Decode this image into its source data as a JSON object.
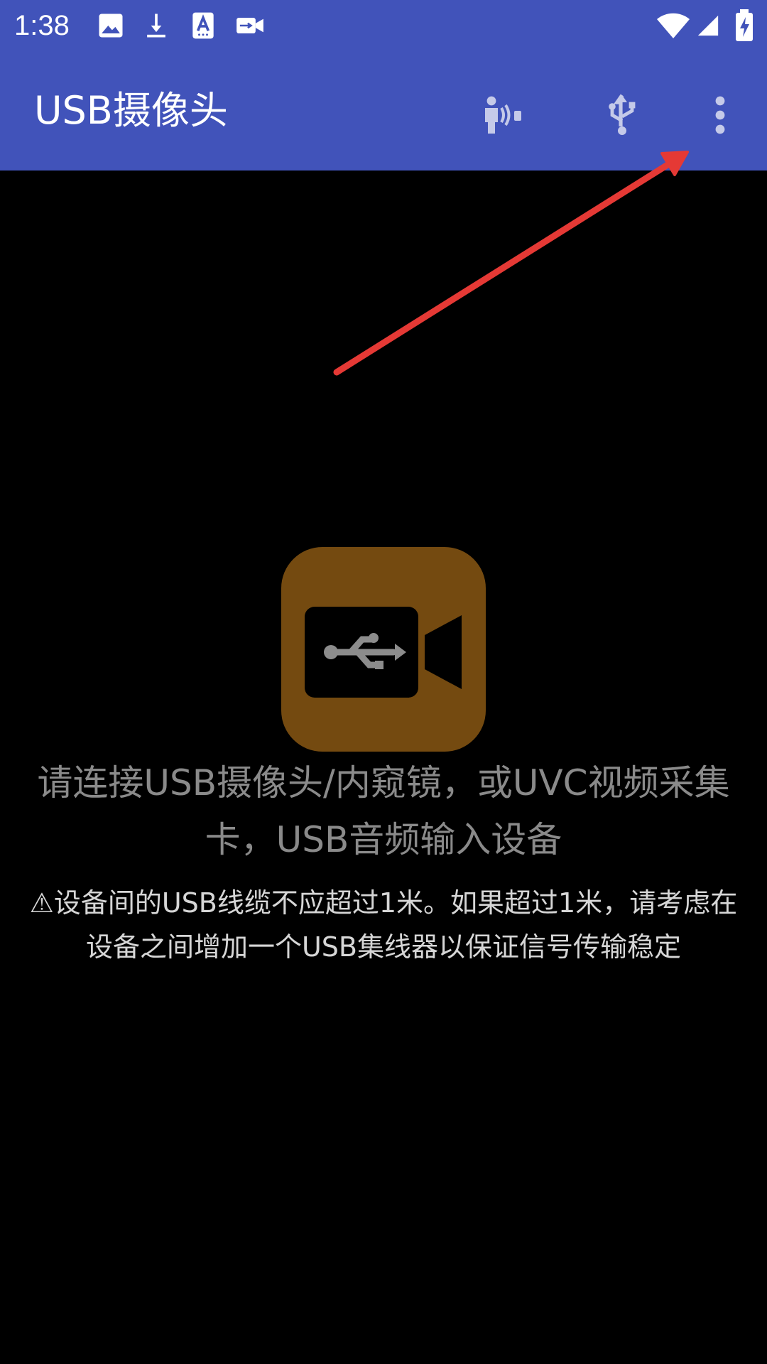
{
  "status_bar": {
    "time": "1:38",
    "notification_icons": [
      "image-icon",
      "download-icon",
      "text-a-icon",
      "usb-video-icon"
    ],
    "right_icons": [
      "wifi-icon",
      "cell-signal-icon",
      "battery-charging-icon"
    ]
  },
  "app_bar": {
    "title": "USB摄像头",
    "actions": [
      {
        "icon": "person-audio-icon",
        "label": ""
      },
      {
        "icon": "usb-icon",
        "label": ""
      },
      {
        "icon": "more-vert-icon",
        "label": ""
      }
    ],
    "background": "#4153BA"
  },
  "annotation": {
    "arrow_color": "#E53935"
  },
  "content": {
    "logo_icon": "usb-camera-icon",
    "logo_color": "#744A10",
    "connect_message": "请连接USB摄像头/内窥镜，或UVC视频采集卡，USB音频输入设备",
    "cable_warning": "⚠设备间的USB线缆不应超过1米。如果超过1米，请考虑在设备之间增加一个USB集线器以保证信号传输稳定"
  }
}
